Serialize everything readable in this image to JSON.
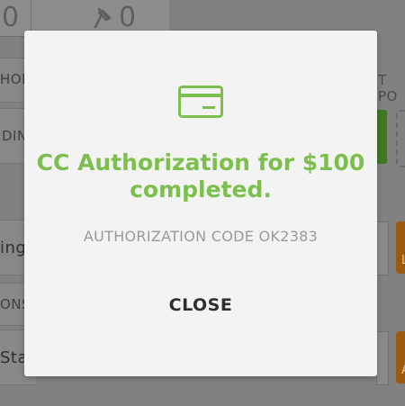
{
  "background": {
    "counters": [
      "0",
      "0"
    ],
    "left_labels": [
      "HOD",
      "DIN",
      "ing",
      "ONS",
      "Star"
    ],
    "right_labels": [
      "T PO"
    ],
    "orange_button_labels": [
      "L",
      "A"
    ]
  },
  "modal": {
    "icon": "credit-card-icon",
    "title_line1": "CC Authorization for $100",
    "title_line2": "completed.",
    "subtitle": "AUTHORIZATION CODE OK2383",
    "close_label": "CLOSE",
    "accent_color": "#7cbf4e"
  }
}
